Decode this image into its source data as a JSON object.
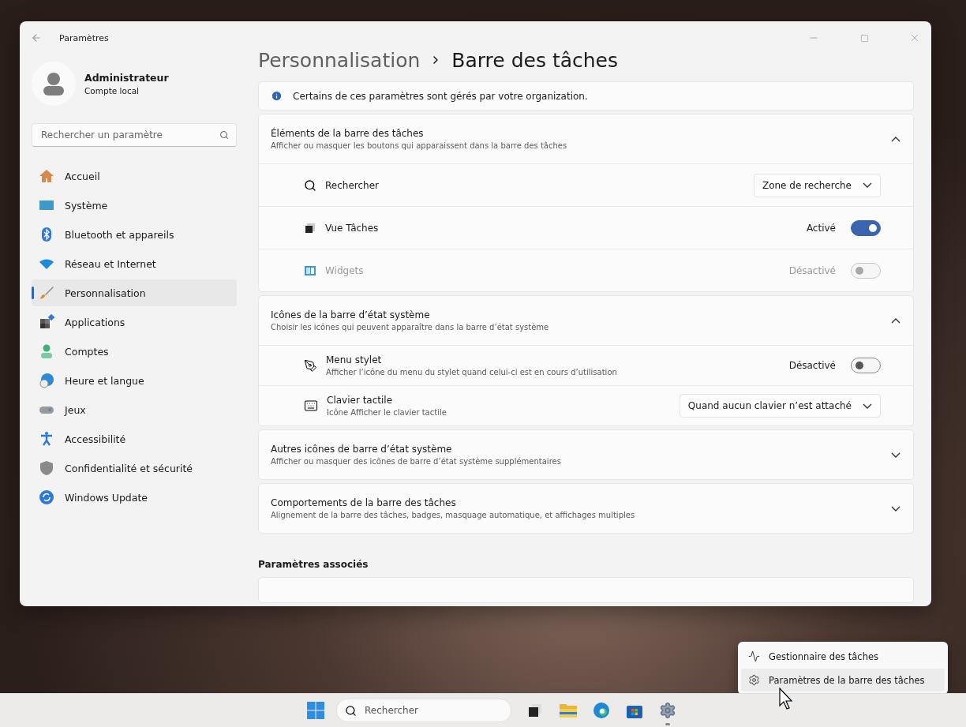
{
  "window": {
    "title": "Paramètres"
  },
  "user": {
    "name": "Administrateur",
    "subtitle": "Compte local"
  },
  "search": {
    "placeholder": "Rechercher un paramètre"
  },
  "nav": [
    {
      "label": "Accueil",
      "kind": "home",
      "selected": false
    },
    {
      "label": "Système",
      "kind": "system",
      "selected": false
    },
    {
      "label": "Bluetooth et appareils",
      "kind": "bluetooth",
      "selected": false
    },
    {
      "label": "Réseau et Internet",
      "kind": "wifi",
      "selected": false
    },
    {
      "label": "Personnalisation",
      "kind": "brush",
      "selected": true
    },
    {
      "label": "Applications",
      "kind": "apps",
      "selected": false
    },
    {
      "label": "Comptes",
      "kind": "account",
      "selected": false
    },
    {
      "label": "Heure et langue",
      "kind": "time",
      "selected": false
    },
    {
      "label": "Jeux",
      "kind": "gamepad",
      "selected": false
    },
    {
      "label": "Accessibilité",
      "kind": "accessibility",
      "selected": false
    },
    {
      "label": "Confidentialité et sécurité",
      "kind": "shield",
      "selected": false
    },
    {
      "label": "Windows Update",
      "kind": "update",
      "selected": false
    }
  ],
  "breadcrumb": {
    "parent": "Personnalisation",
    "current": "Barre des tâches"
  },
  "notice": "Certains de ces paramètres sont gérés par votre organization.",
  "sections": [
    {
      "title": "Éléments de la barre des tâches",
      "subtitle": "Afficher ou masquer les boutons qui apparaissent dans la barre des tâches",
      "expanded": true,
      "rows": [
        {
          "kind": "dropdown",
          "label": "Rechercher",
          "value": "Zone de recherche",
          "disabled": false
        },
        {
          "kind": "toggle",
          "label": "Vue Tâches",
          "value": "Activé",
          "on": true,
          "disabled": false
        },
        {
          "kind": "toggle",
          "label": "Widgets",
          "value": "Désactivé",
          "on": false,
          "disabled": true
        }
      ]
    },
    {
      "title": "Icônes de la barre d’état système",
      "subtitle": "Choisir les icônes qui peuvent apparaître dans la barre d’état système",
      "expanded": true,
      "rows": [
        {
          "kind": "toggle",
          "label": "Menu stylet",
          "subtitle": "Afficher l’icône du menu du stylet quand celui-ci est en cours d’utilisation",
          "value": "Désactivé",
          "on": false,
          "disabled": false
        },
        {
          "kind": "dropdown",
          "label": "Clavier tactile",
          "subtitle": "Icône Afficher le clavier tactile",
          "value": "Quand aucun clavier n’est attaché",
          "disabled": false
        }
      ]
    },
    {
      "title": "Autres icônes de barre d’état système",
      "subtitle": "Afficher ou masquer des icônes de barre d’état système supplémentaires",
      "expanded": false
    },
    {
      "title": "Comportements de la barre des tâches",
      "subtitle": "Alignement de la barre des tâches, badges, masquage automatique, et affichages multiples",
      "expanded": false
    }
  ],
  "related": {
    "title": "Paramètres associés"
  },
  "context_menu": [
    {
      "label": "Gestionnaire des tâches",
      "kind": "taskmanager",
      "selected": false
    },
    {
      "label": "Paramètres de la barre des tâches",
      "kind": "settings",
      "selected": true
    }
  ],
  "taskbar": {
    "search_placeholder": "Rechercher"
  }
}
